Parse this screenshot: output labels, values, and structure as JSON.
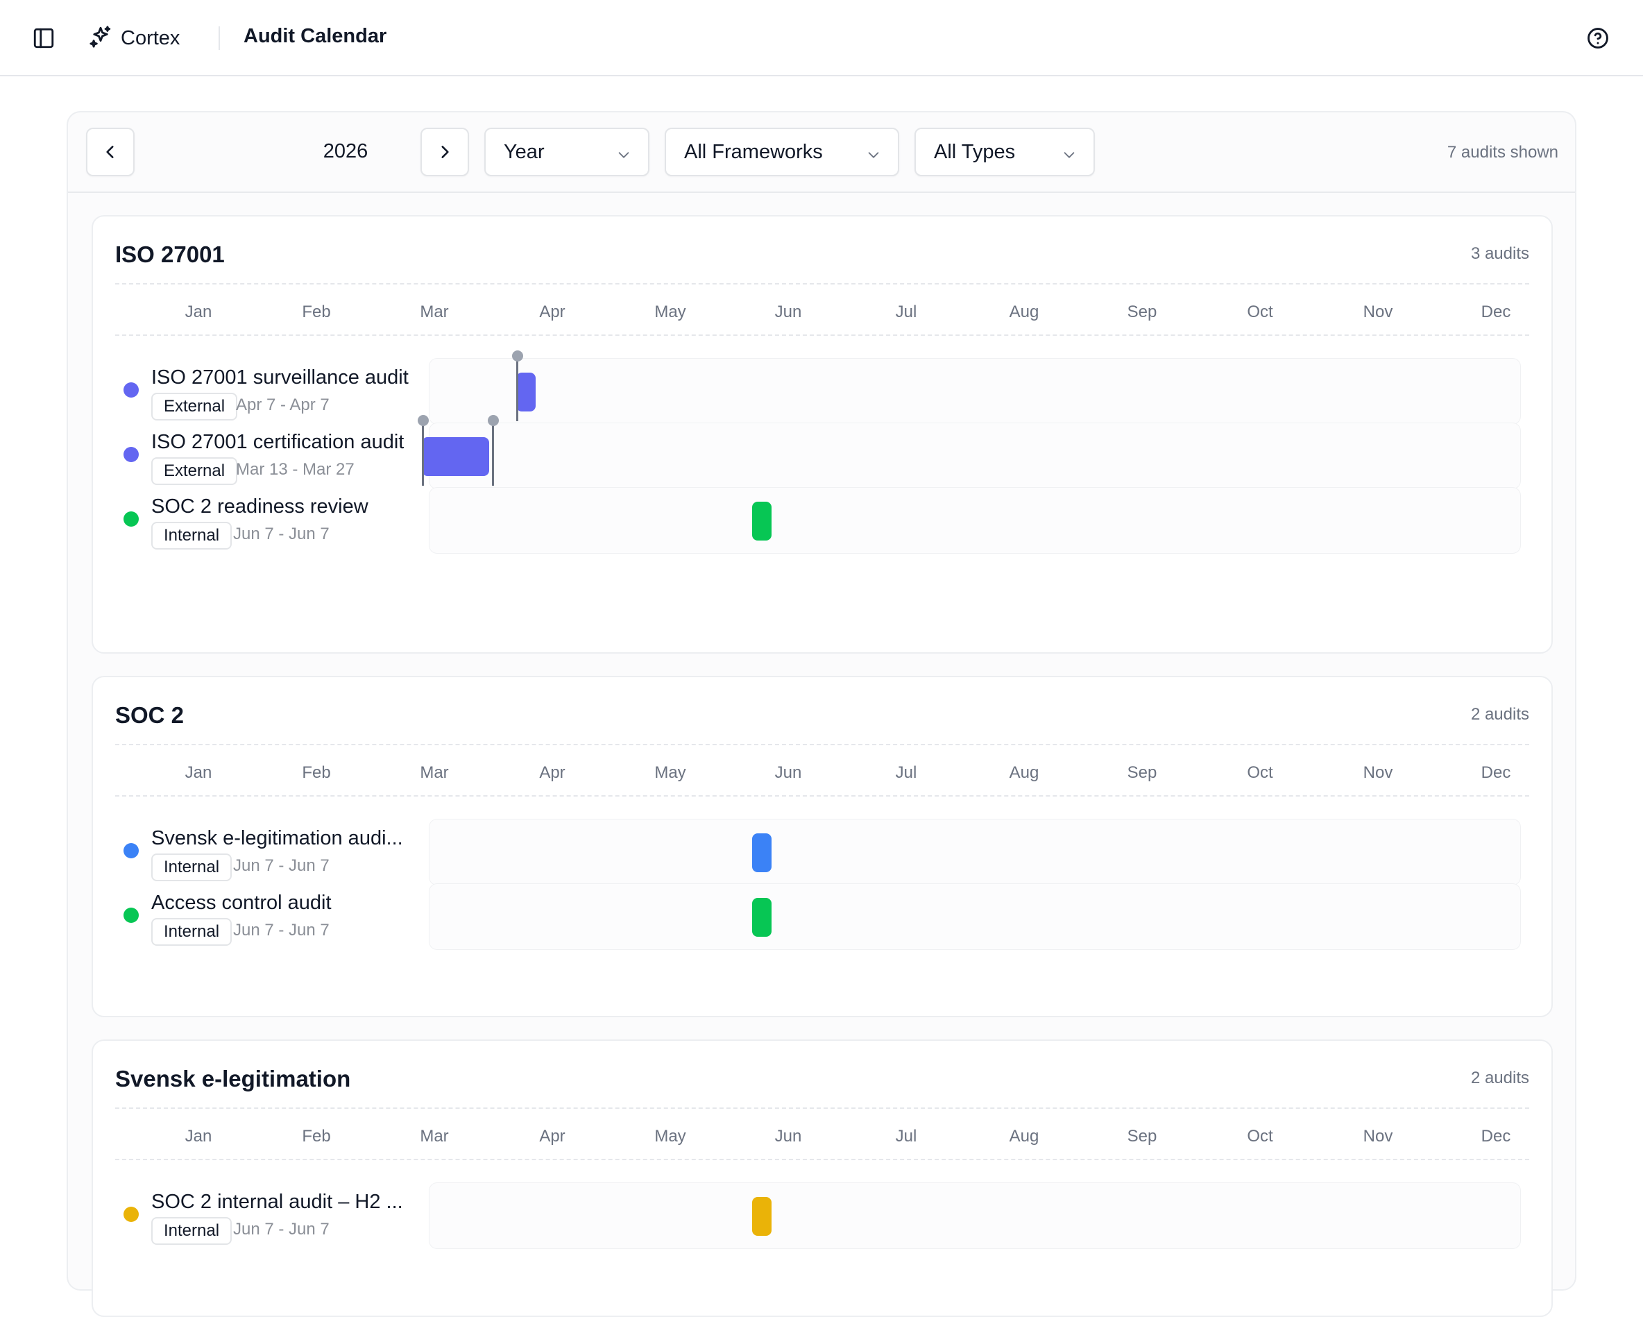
{
  "header": {
    "brand": "Cortex",
    "page_title": "Audit Calendar"
  },
  "toolbar": {
    "year": "2026",
    "period": "Year",
    "framework_filter": "All Frameworks",
    "type_filter": "All Types",
    "count_label": "7 audits shown"
  },
  "months": [
    "Jan",
    "Feb",
    "Mar",
    "Apr",
    "May",
    "Jun",
    "Jul",
    "Aug",
    "Sep",
    "Oct",
    "Nov",
    "Dec"
  ],
  "groups": [
    {
      "title": "ISO 27001",
      "count_label": "3 audits",
      "audits": [
        {
          "name": "ISO 27001 surveillance audit",
          "type": "External",
          "dates": "Apr 7 - Apr 7",
          "color": "#6366f1",
          "start": {
            "month": 4,
            "day": 7
          },
          "end": {
            "month": 4,
            "day": 7
          },
          "markers": 1
        },
        {
          "name": "ISO 27001 certification audit",
          "type": "External",
          "dates": "Mar 13 - Mar 27",
          "color": "#6366f1",
          "start": {
            "month": 3,
            "day": 13
          },
          "end": {
            "month": 3,
            "day": 27
          },
          "markers": 2
        },
        {
          "name": "SOC 2 readiness review",
          "type": "Internal",
          "dates": "Jun 7 - Jun 7",
          "color": "#07c654",
          "start": {
            "month": 6,
            "day": 7
          },
          "end": {
            "month": 6,
            "day": 7
          },
          "markers": 0
        }
      ]
    },
    {
      "title": "SOC 2",
      "count_label": "2 audits",
      "audits": [
        {
          "name": "Svensk e-legitimation audi...",
          "type": "Internal",
          "dates": "Jun 7 - Jun 7",
          "color": "#3b82f6",
          "start": {
            "month": 6,
            "day": 7
          },
          "end": {
            "month": 6,
            "day": 7
          },
          "markers": 0
        },
        {
          "name": "Access control audit",
          "type": "Internal",
          "dates": "Jun 7 - Jun 7",
          "color": "#07c654",
          "start": {
            "month": 6,
            "day": 7
          },
          "end": {
            "month": 6,
            "day": 7
          },
          "markers": 0
        }
      ]
    },
    {
      "title": "Svensk e-legitimation",
      "count_label": "2 audits",
      "audits": [
        {
          "name": "SOC 2 internal audit – H2 ...",
          "type": "Internal",
          "dates": "Jun 7 - Jun 7",
          "color": "#eab308",
          "start": {
            "month": 6,
            "day": 7
          },
          "end": {
            "month": 6,
            "day": 7
          },
          "markers": 0
        }
      ]
    }
  ],
  "icons": {
    "sidebar_toggle": "sidebar-icon",
    "brand": "sparkles-icon",
    "help": "help-circle-icon",
    "prev": "chevron-left-icon",
    "next": "chevron-right-icon",
    "dropdown": "chevron-down-icon"
  }
}
